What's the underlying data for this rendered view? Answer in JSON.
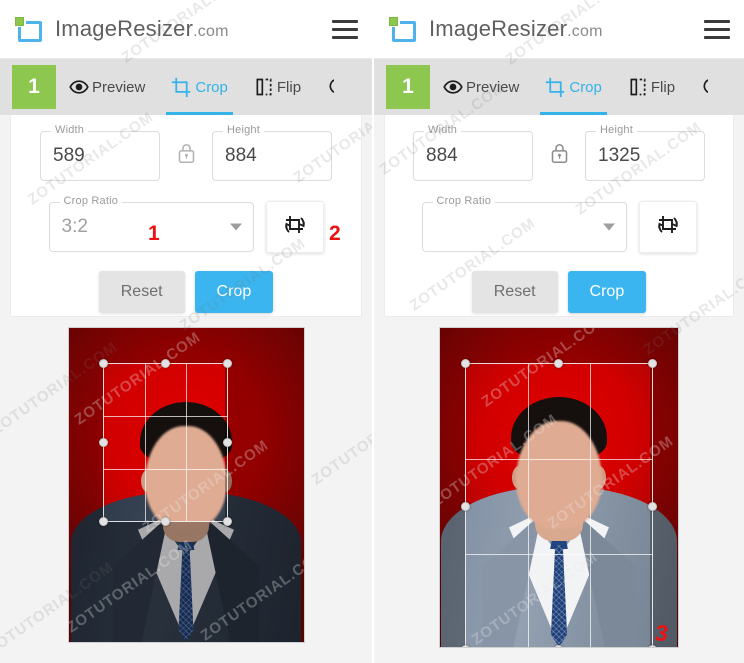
{
  "app": {
    "brand_name": "ImageResizer",
    "brand_tld": ".com",
    "logo_icon": "resize-frame-icon",
    "menu_icon": "hamburger-menu-icon"
  },
  "watermark": {
    "text": "ZOTUTORIAL.COM"
  },
  "panels": [
    {
      "id": "left",
      "step_badge": "1",
      "tabs": [
        {
          "label": "Preview",
          "icon": "eye-icon",
          "active": false
        },
        {
          "label": "Crop",
          "icon": "crop-icon",
          "active": true
        },
        {
          "label": "Flip",
          "icon": "flip-horizontal-icon",
          "active": false
        },
        {
          "label": "",
          "icon": "rotate-icon",
          "active": false
        }
      ],
      "controls": {
        "width_label": "Width",
        "width_value": "589",
        "lock_icon": "lock-closed-icon",
        "height_label": "Height",
        "height_value": "884",
        "ratio_label": "Crop Ratio",
        "ratio_value": "3:2",
        "ratio_caret_icon": "chevron-down-icon",
        "rotate_button_icon": "crop-rotate-icon",
        "reset_label": "Reset",
        "crop_label": "Crop"
      },
      "annotations": [
        {
          "number": "1",
          "target": "crop-ratio-select"
        },
        {
          "number": "2",
          "target": "crop-rotate-button"
        }
      ]
    },
    {
      "id": "right",
      "step_badge": "1",
      "tabs": [
        {
          "label": "Preview",
          "icon": "eye-icon",
          "active": false
        },
        {
          "label": "Crop",
          "icon": "crop-icon",
          "active": true
        },
        {
          "label": "Flip",
          "icon": "flip-horizontal-icon",
          "active": false
        },
        {
          "label": "",
          "icon": "rotate-icon",
          "active": false
        }
      ],
      "controls": {
        "width_label": "Width",
        "width_value": "884",
        "lock_icon": "lock-closed-icon",
        "height_label": "Height",
        "height_value": "1325",
        "ratio_label": "Crop Ratio",
        "ratio_value": "",
        "ratio_caret_icon": "chevron-down-icon",
        "rotate_button_icon": "crop-rotate-icon",
        "reset_label": "Reset",
        "crop_label": "Crop"
      },
      "annotations": [
        {
          "number": "3",
          "target": "cropped-photo-preview"
        }
      ]
    }
  ],
  "colors": {
    "accent_blue": "#3ab5ef",
    "step_green": "#8ec750",
    "annotation_red": "#ee1111",
    "tabbar_gray": "#e0e0e0",
    "photo_background_red": "#d10000"
  }
}
